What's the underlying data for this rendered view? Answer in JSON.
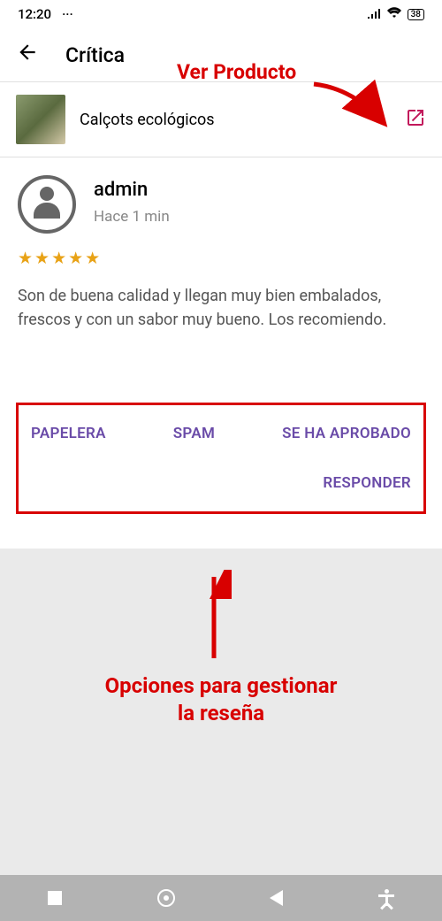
{
  "status": {
    "time": "12:20",
    "more": "···",
    "battery": "38"
  },
  "header": {
    "title": "Crítica"
  },
  "annotations": {
    "top": "Ver Producto",
    "bottom_line1": "Opciones para gestionar",
    "bottom_line2": "la reseña"
  },
  "product": {
    "name": "Calçots ecológicos"
  },
  "review": {
    "username": "admin",
    "time_ago": "Hace 1 min",
    "stars": "★★★★★",
    "text": "Son de buena calidad y llegan muy bien embalados, frescos y con un sabor muy bueno. Los recomiendo."
  },
  "actions": {
    "trash": "PAPELERA",
    "spam": "SPAM",
    "approved": "SE HA APROBADO",
    "reply": "RESPONDER"
  }
}
